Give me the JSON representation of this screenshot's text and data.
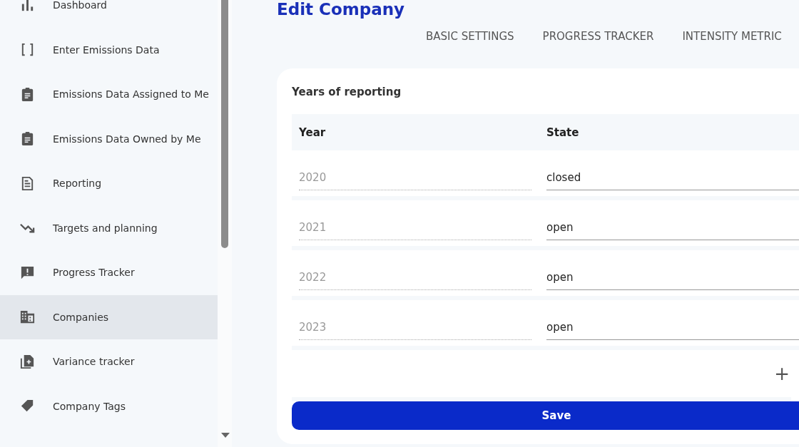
{
  "sidebar": {
    "items": [
      {
        "label": "Dashboard",
        "selected": false
      },
      {
        "label": "Enter Emissions Data",
        "selected": false
      },
      {
        "label": "Emissions Data Assigned to Me",
        "selected": false
      },
      {
        "label": "Emissions Data Owned by Me",
        "selected": false
      },
      {
        "label": "Reporting",
        "selected": false
      },
      {
        "label": "Targets and planning",
        "selected": false
      },
      {
        "label": "Progress Tracker",
        "selected": false
      },
      {
        "label": "Companies",
        "selected": true
      },
      {
        "label": "Variance tracker",
        "selected": false
      },
      {
        "label": "Company Tags",
        "selected": false
      }
    ]
  },
  "page": {
    "title": "Edit Company"
  },
  "tabs": [
    {
      "label": "BASIC SETTINGS",
      "selected": false
    },
    {
      "label": "PROGRESS TRACKER",
      "selected": false
    },
    {
      "label": "INTENSITY METRIC",
      "selected": false
    }
  ],
  "card": {
    "title": "Years of reporting",
    "columns": [
      "Year",
      "State"
    ],
    "rows": [
      {
        "year": "2020",
        "state": "closed"
      },
      {
        "year": "2021",
        "state": "open"
      },
      {
        "year": "2022",
        "state": "open"
      },
      {
        "year": "2023",
        "state": "open"
      }
    ],
    "add_label": "+",
    "save_label": "Save"
  }
}
